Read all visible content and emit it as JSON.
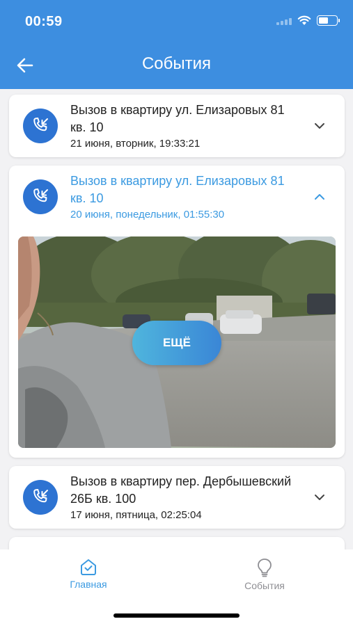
{
  "status_bar": {
    "time": "00:59",
    "wifi_icon": "wifi-icon",
    "battery_icon": "battery-icon",
    "battery_level": 0.55
  },
  "header": {
    "title": "События",
    "back_icon": "back-arrow-icon"
  },
  "events": [
    {
      "title": "Вызов в квартиру ул. Елизаровых 81 кв. 10",
      "date": "21 июня, вторник, 19:33:21",
      "icon": "incoming-call-icon",
      "expanded": false
    },
    {
      "title": "Вызов в квартиру ул. Елизаровых 81 кв. 10",
      "date": "20 июня, понедельник, 01:55:30",
      "icon": "incoming-call-icon",
      "expanded": true,
      "more_label": "ЕЩЁ"
    },
    {
      "title": "Вызов в квартиру пер. Дербышевский 26Б кв. 100",
      "date": "17 июня, пятница, 02:25:04",
      "icon": "incoming-call-icon",
      "expanded": false
    }
  ],
  "tabbar": {
    "tabs": [
      {
        "label": "Главная",
        "icon": "home-icon",
        "active": true
      },
      {
        "label": "События",
        "icon": "lightbulb-icon",
        "active": false
      }
    ]
  },
  "colors": {
    "header": "#3d8ee0",
    "accent": "#3b9ae1",
    "icon_bg": "#2d73d2",
    "inactive_tab": "#8e8e93"
  }
}
